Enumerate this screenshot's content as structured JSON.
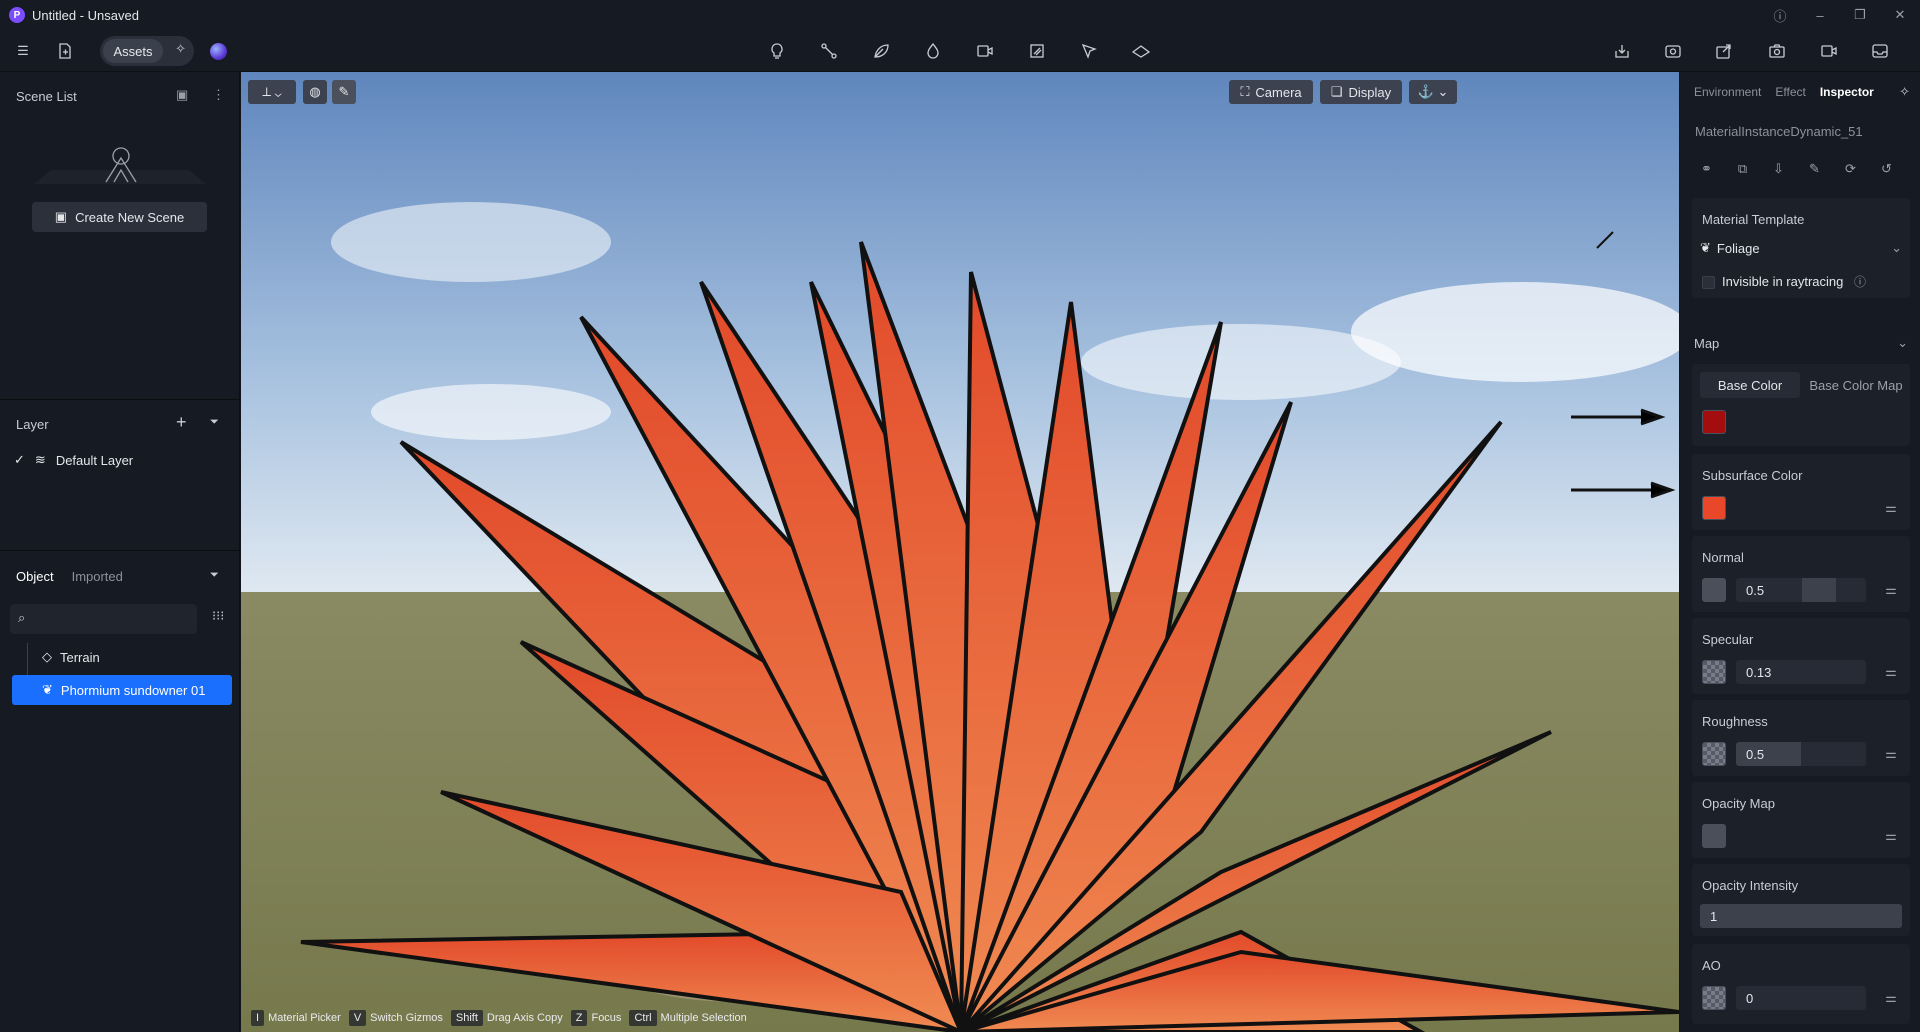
{
  "titlebar": {
    "title": "Untitled - Unsaved",
    "logo": "P"
  },
  "toolbar": {
    "assets_label": "Assets"
  },
  "scene_list": {
    "title": "Scene List",
    "create_label": "Create New Scene"
  },
  "layer": {
    "title": "Layer",
    "items": [
      {
        "label": "Default Layer"
      }
    ]
  },
  "objects": {
    "tabs": [
      "Object",
      "Imported"
    ],
    "items": [
      {
        "label": "Terrain"
      },
      {
        "label": "Phormium sundowner 01"
      }
    ]
  },
  "viewport": {
    "camera_label": "Camera",
    "display_label": "Display",
    "shortcuts": [
      {
        "key": "I",
        "label": "Material Picker"
      },
      {
        "key": "V",
        "label": "Switch Gizmos"
      },
      {
        "key": "Shift",
        "label": "Drag Axis Copy"
      },
      {
        "key": "Z",
        "label": "Focus"
      },
      {
        "key": "Ctrl",
        "label": "Multiple Selection"
      }
    ]
  },
  "inspector": {
    "tabs": [
      "Environment",
      "Effect",
      "Inspector"
    ],
    "material_name": "MaterialInstanceDynamic_51",
    "template_label": "Material Template",
    "template_value": "Foliage",
    "invisible_label": "Invisible in raytracing",
    "map_label": "Map",
    "base_color_tab": "Base Color",
    "base_color_map_tab": "Base Color Map",
    "base_color": "#a40d0d",
    "subsurface_label": "Subsurface Color",
    "subsurface_color": "#e8472a",
    "normal_label": "Normal",
    "normal_value": "0.5",
    "specular_label": "Specular",
    "specular_value": "0.13",
    "roughness_label": "Roughness",
    "roughness_value": "0.5",
    "opacity_map_label": "Opacity Map",
    "opacity_intensity_label": "Opacity Intensity",
    "opacity_intensity_value": "1",
    "ao_label": "AO",
    "ao_value": "0"
  },
  "colors": {
    "accent": "#1a6fff",
    "panel_bg": "#161a22"
  }
}
